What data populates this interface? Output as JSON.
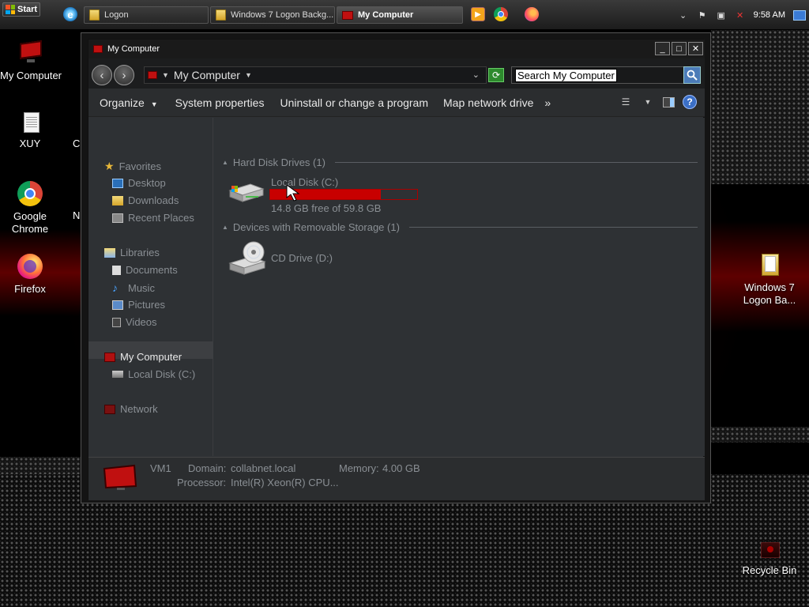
{
  "taskbar": {
    "start_label": "Start",
    "tasks": [
      {
        "label": "Logon",
        "icon": "folder-icon"
      },
      {
        "label": "Windows 7 Logon Backg...",
        "icon": "folder-icon"
      },
      {
        "label": "My Computer",
        "icon": "computer-icon",
        "active": true
      }
    ],
    "quick_launch": [
      "internet-explorer-icon",
      "media-player-icon",
      "chrome-icon",
      "firefox-icon"
    ],
    "tray": {
      "icons": [
        "chevron-up-icon",
        "flag-icon",
        "network-icon",
        "volume-muted-icon"
      ],
      "clock": "9:58 AM"
    }
  },
  "desktop": {
    "icons": [
      {
        "label": "My Computer",
        "icon": "computer-icon"
      },
      {
        "label": "XUY",
        "icon": "document-icon"
      },
      {
        "label": "Google Chrome",
        "icon": "chrome-icon"
      },
      {
        "label": "Firefox",
        "icon": "firefox-icon"
      },
      {
        "label": "Windows 7 Logon Ba...",
        "icon": "folder-icon"
      },
      {
        "label": "Recycle Bin",
        "icon": "recycle-bin-icon"
      }
    ],
    "partial_labels": [
      "C",
      "N"
    ]
  },
  "window": {
    "title": "My Computer",
    "controls": {
      "minimize": "_",
      "maximize": "□",
      "close": "✕"
    },
    "address": {
      "location": "My Computer"
    },
    "search": {
      "value": "Search My Computer"
    },
    "toolbar": {
      "organize": "Organize",
      "system_properties": "System properties",
      "uninstall": "Uninstall or change a program",
      "map_drive": "Map network drive",
      "more": "»"
    },
    "nav": {
      "favorites": "Favorites",
      "desktop": "Desktop",
      "downloads": "Downloads",
      "recent": "Recent Places",
      "libraries": "Libraries",
      "documents": "Documents",
      "music": "Music",
      "pictures": "Pictures",
      "videos": "Videos",
      "my_computer": "My Computer",
      "local_disk": "Local Disk (C:)",
      "network": "Network"
    },
    "content": {
      "hdd_group": "Hard Disk Drives (1)",
      "removable_group": "Devices with Removable Storage (1)",
      "drive_c": {
        "name": "Local Disk (C:)",
        "free_text": "14.8 GB free of 59.8 GB",
        "used_fraction": 0.752
      },
      "drive_d": {
        "name": "CD Drive (D:)"
      }
    },
    "details": {
      "name": "VM1",
      "domain_label": "Domain:",
      "domain_value": "collabnet.local",
      "memory_label": "Memory:",
      "memory_value": "4.00 GB",
      "processor_label": "Processor:",
      "processor_value": "Intel(R) Xeon(R) CPU..."
    }
  }
}
